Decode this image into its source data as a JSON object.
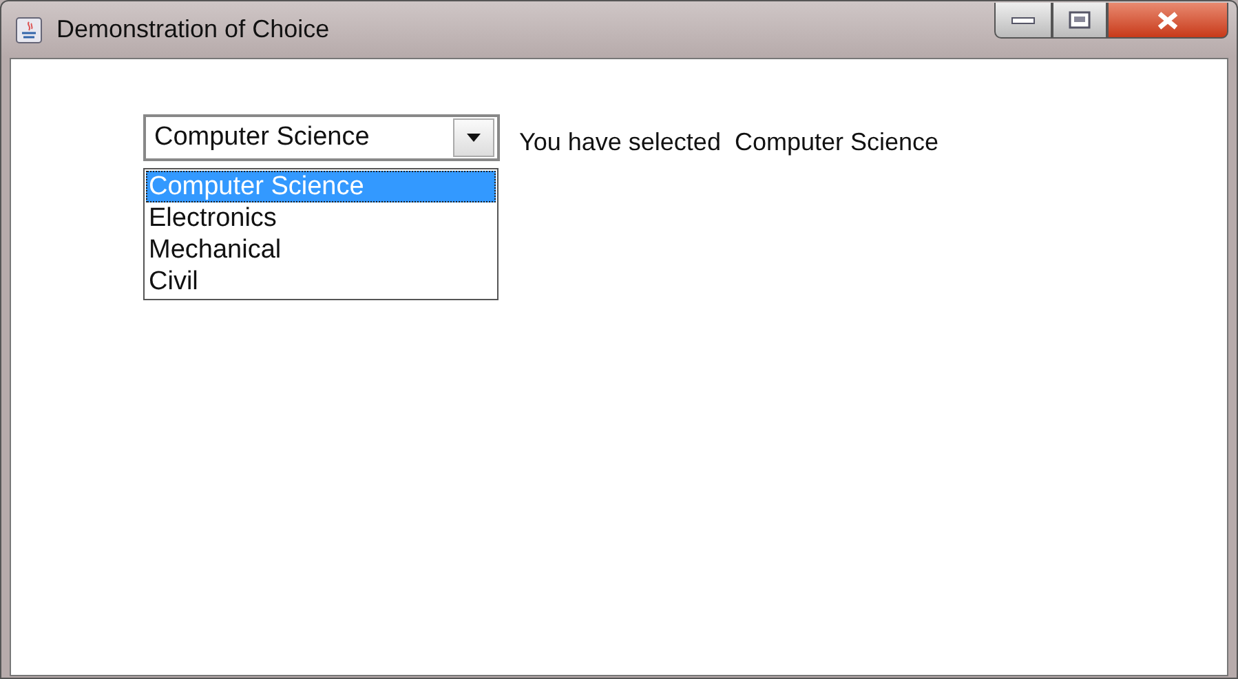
{
  "window": {
    "title": "Demonstration of Choice"
  },
  "choice": {
    "value": "Computer Science",
    "expanded": true,
    "options": [
      {
        "label": "Computer Science",
        "selected": true
      },
      {
        "label": "Electronics",
        "selected": false
      },
      {
        "label": "Mechanical",
        "selected": false
      },
      {
        "label": "Civil",
        "selected": false
      }
    ]
  },
  "selection_label": "You have selected  Computer Science"
}
